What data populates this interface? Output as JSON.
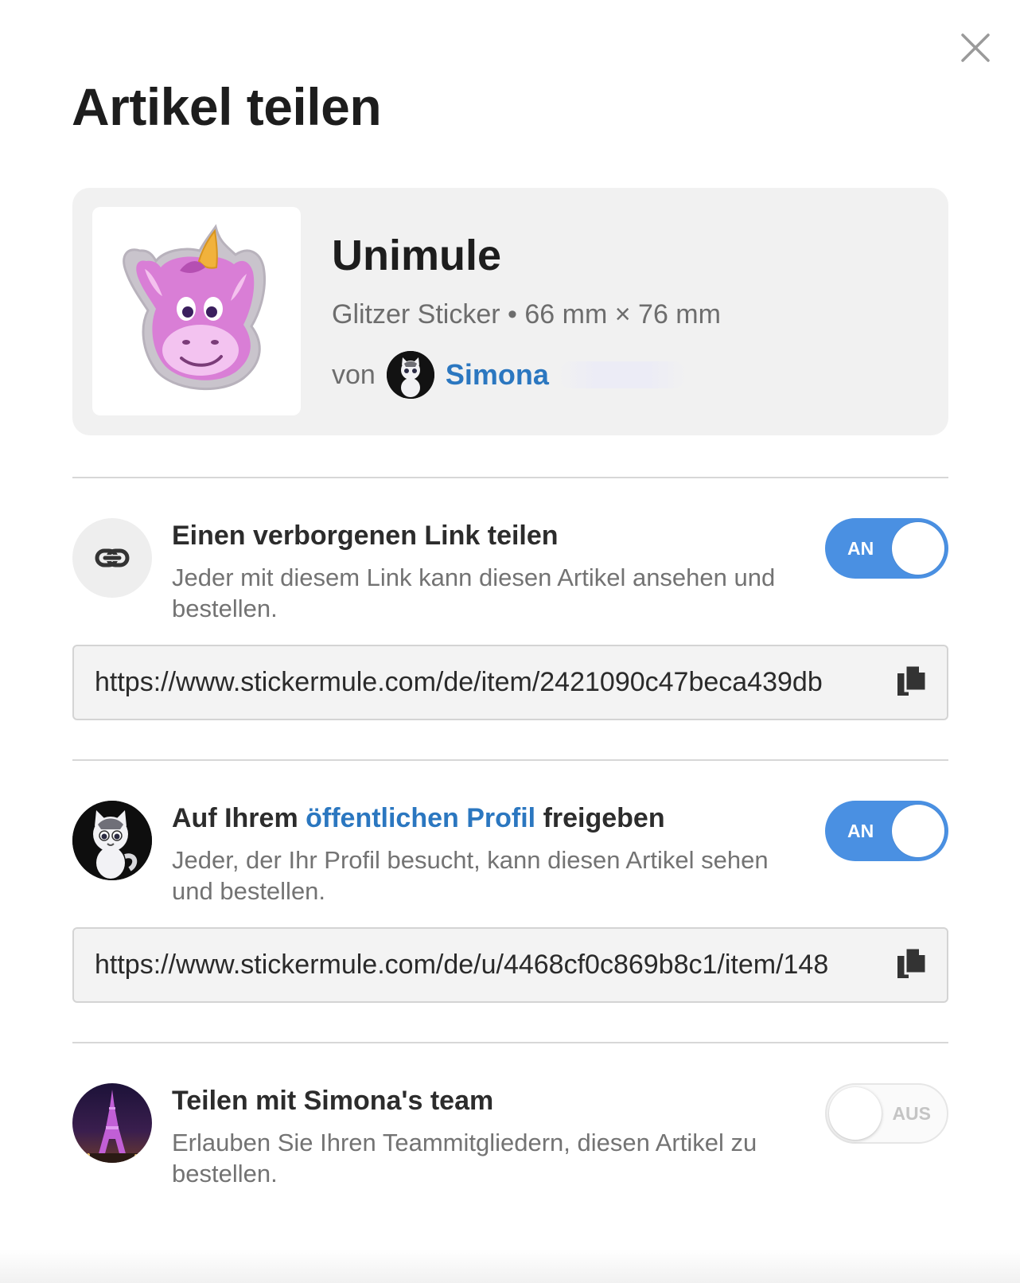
{
  "dialog": {
    "title": "Artikel teilen",
    "close_icon": "close-icon"
  },
  "product": {
    "name": "Unimule",
    "meta": "Glitzer Sticker • 66 mm × 76 mm",
    "author_prefix": "von",
    "author_name": "Simona",
    "thumbnail_icon": "unicorn-sticker-image",
    "author_avatar_icon": "cat-avatar"
  },
  "hidden_link": {
    "icon": "link-icon",
    "title": "Einen verborgenen Link teilen",
    "description": "Jeder mit diesem Link kann diesen Artikel ansehen und bestellen.",
    "toggle_label": "AN",
    "toggle_on": true,
    "url": "https://www.stickermule.com/de/item/2421090c47beca439db",
    "copy_icon": "copy-icon"
  },
  "public_profile": {
    "icon": "cat-avatar",
    "title_before": "Auf Ihrem ",
    "title_link": "öffentlichen Profil",
    "title_after": " freigeben",
    "description": "Jeder, der Ihr Profil besucht, kann diesen Artikel sehen und bestellen.",
    "toggle_label": "AN",
    "toggle_on": true,
    "url": "https://www.stickermule.com/de/u/4468cf0c869b8c1/item/148",
    "copy_icon": "copy-icon"
  },
  "team": {
    "icon": "eiffel-tower-avatar",
    "title": "Teilen mit Simona's team",
    "description": "Erlauben Sie Ihren Teammitgliedern, diesen Artikel zu bestellen.",
    "toggle_label": "AUS",
    "toggle_on": false
  },
  "colors": {
    "accent": "#4a90e2",
    "link": "#2b77c0",
    "card_bg": "#f1f1f1"
  }
}
